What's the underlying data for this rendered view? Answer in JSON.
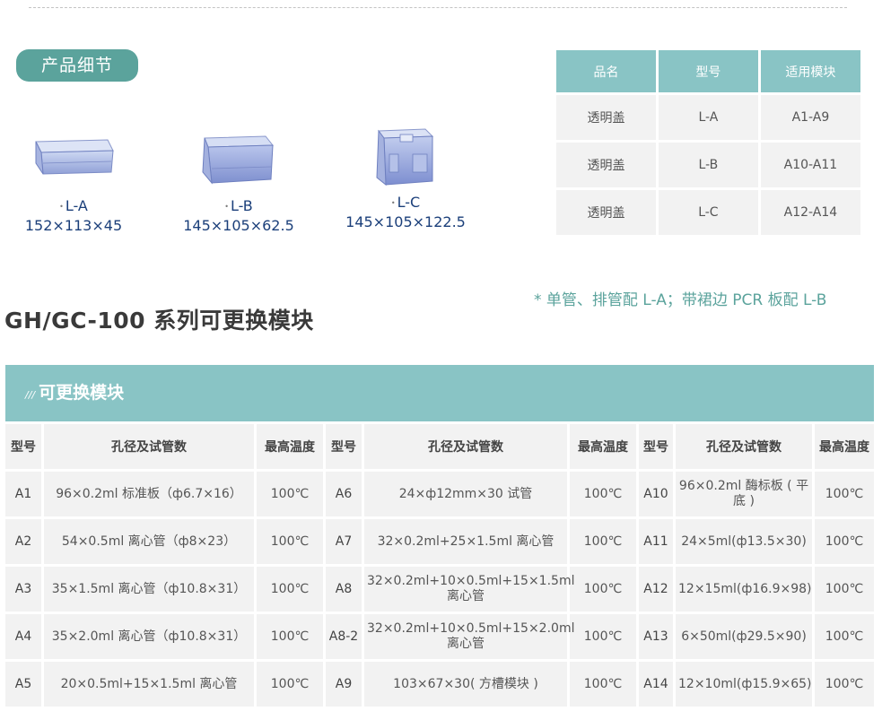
{
  "section_label": "产品细节",
  "products": [
    {
      "label": "L-A",
      "dims": "152×113×45"
    },
    {
      "label": "L-B",
      "dims": "145×105×62.5"
    },
    {
      "label": "L-C",
      "dims": "145×105×122.5"
    }
  ],
  "cover_table": {
    "headers": [
      "品名",
      "型号",
      "适用模块"
    ],
    "rows": [
      [
        "透明盖",
        "L-A",
        "A1-A9"
      ],
      [
        "透明盖",
        "L-B",
        "A10-A11"
      ],
      [
        "透明盖",
        "L-C",
        "A12-A14"
      ]
    ]
  },
  "note": "* 单管、排管配 L-A；带裙边 PCR 板配 L-B",
  "series_title": "GH/GC-100 系列可更换模块",
  "module_table": {
    "title_mark": "///",
    "title": "可更换模块",
    "headers": [
      "型号",
      "孔径及试管数",
      "最高温度",
      "型号",
      "孔径及试管数",
      "最高温度",
      "型号",
      "孔径及试管数",
      "最高温度"
    ],
    "rows": [
      [
        "A1",
        "96×0.2ml 标准板（ф6.7×16）",
        "100℃",
        "A6",
        "24×ф12mm×30 试管",
        "100℃",
        "A10",
        "96×0.2ml 酶标板 ( 平底 )",
        "100℃"
      ],
      [
        "A2",
        "54×0.5ml 离心管（ф8×23）",
        "100℃",
        "A7",
        "32×0.2ml+25×1.5ml 离心管",
        "100℃",
        "A11",
        "24×5ml(ф13.5×30)",
        "100℃"
      ],
      [
        "A3",
        "35×1.5ml 离心管（ф10.8×31）",
        "100℃",
        "A8",
        "32×0.2ml+10×0.5ml+15×1.5ml 离心管",
        "100℃",
        "A12",
        "12×15ml(ф16.9×98)",
        "100℃"
      ],
      [
        "A4",
        "35×2.0ml 离心管（ф10.8×31）",
        "100℃",
        "A8-2",
        "32×0.2ml+10×0.5ml+15×2.0ml 离心管",
        "100℃",
        "A13",
        "6×50ml(ф29.5×90)",
        "100℃"
      ],
      [
        "A5",
        "20×0.5ml+15×1.5ml 离心管",
        "100℃",
        "A9",
        "103×67×30( 方槽模块 )",
        "100℃",
        "A14",
        "12×10ml(ф15.9×65)",
        "100℃"
      ]
    ]
  },
  "colors": {
    "teal": "#5ba39c",
    "header_teal": "#89c4c5",
    "cell_gray": "#f2f2f2",
    "dim_blue": "#1b3f7a"
  },
  "icons": [
    "transparent-lid-l-a-image",
    "transparent-lid-l-b-image",
    "transparent-lid-l-c-image"
  ]
}
